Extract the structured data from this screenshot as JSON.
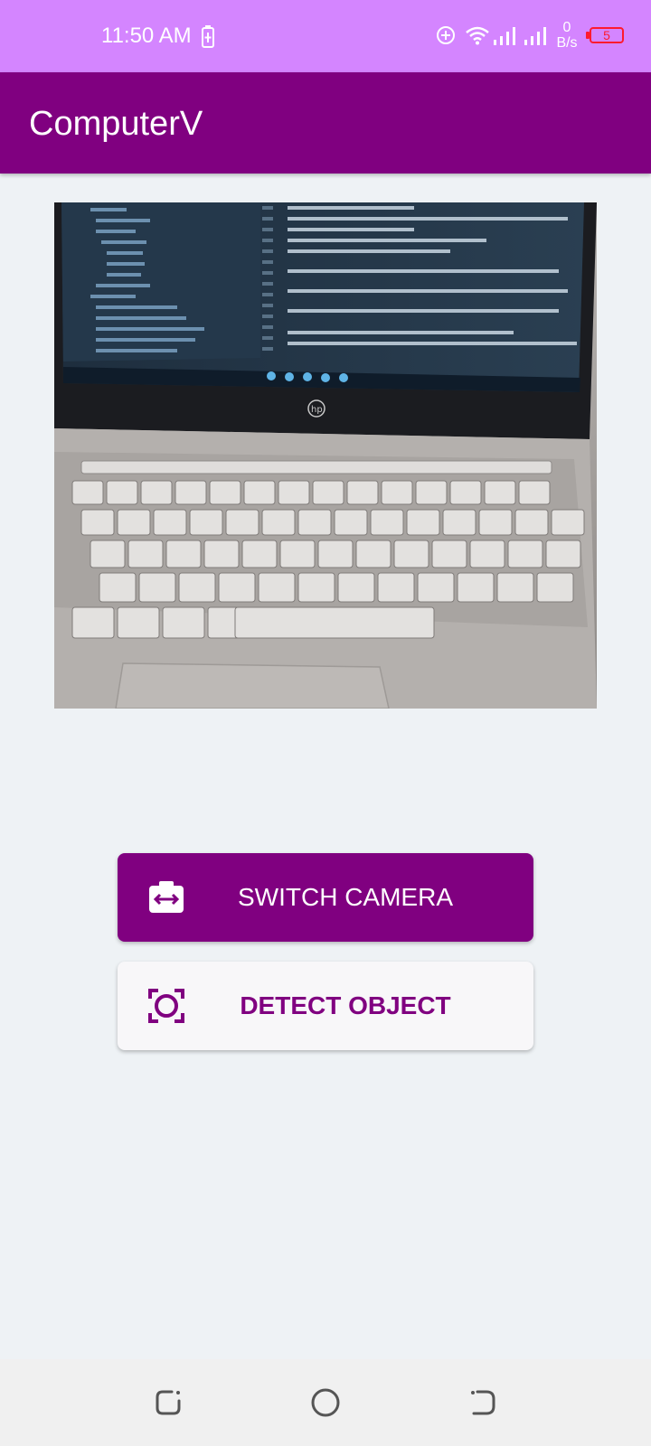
{
  "status_bar": {
    "time": "11:50 AM",
    "net_speed_value": "0",
    "net_speed_unit": "B/s",
    "battery_level": "5",
    "bg_color": "#d485ff",
    "icons": [
      "battery-charging-icon",
      "data-saver-icon",
      "wifi-icon",
      "signal-icon",
      "signal-icon",
      "battery-icon"
    ]
  },
  "app_bar": {
    "title": "ComputerV",
    "bg_color": "#800080"
  },
  "preview": {
    "description_icon": "camera-preview-image"
  },
  "buttons": {
    "switch_camera": "SWITCH CAMERA",
    "switch_camera_icon": "switch-camera-icon",
    "detect_object": "DETECT OBJECT",
    "detect_object_icon": "center-focus-icon"
  },
  "nav_bar": {
    "icons": [
      "recent-apps-icon",
      "home-icon",
      "back-icon"
    ]
  },
  "colors": {
    "accent": "#800080",
    "background": "#eef2f5"
  }
}
